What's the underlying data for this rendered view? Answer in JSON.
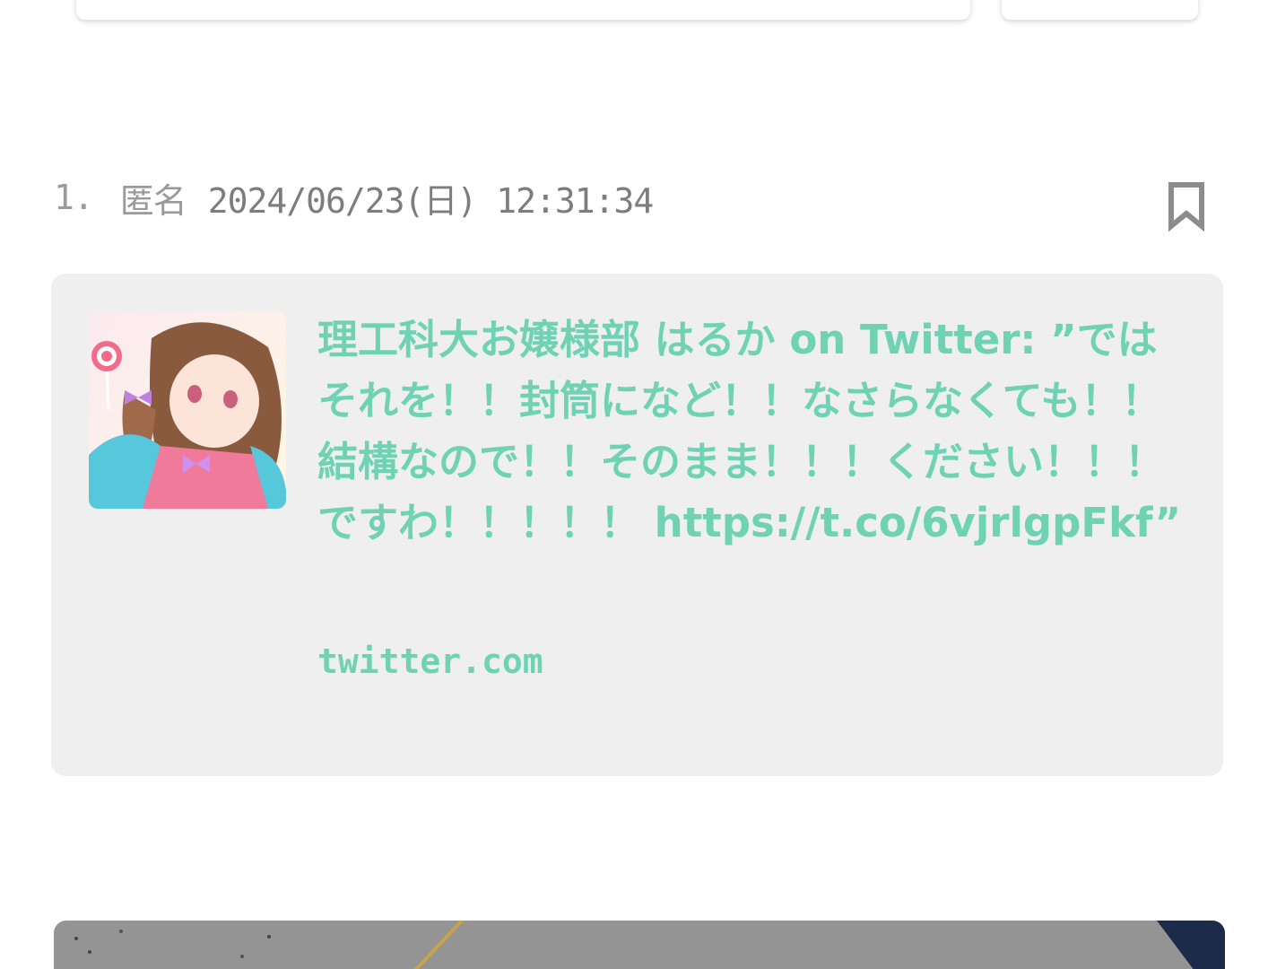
{
  "comment": {
    "number": "1.",
    "author": "匿名",
    "datetime": "2024/06/23(日) 12:31:34",
    "bookmark_icon": "bookmark-icon"
  },
  "embed": {
    "title": "理工科大お嬢様部 はるか on Twitter: ”ではそれを！！封筒になど！！なさらなくても！！結構なので！！そのまま！！！ください！！！ですわ！！！！！ https://t.co/6vjrlgpFkf”",
    "domain": "twitter.com",
    "link_color": "#6fd3b3",
    "background_color": "#efefef"
  }
}
